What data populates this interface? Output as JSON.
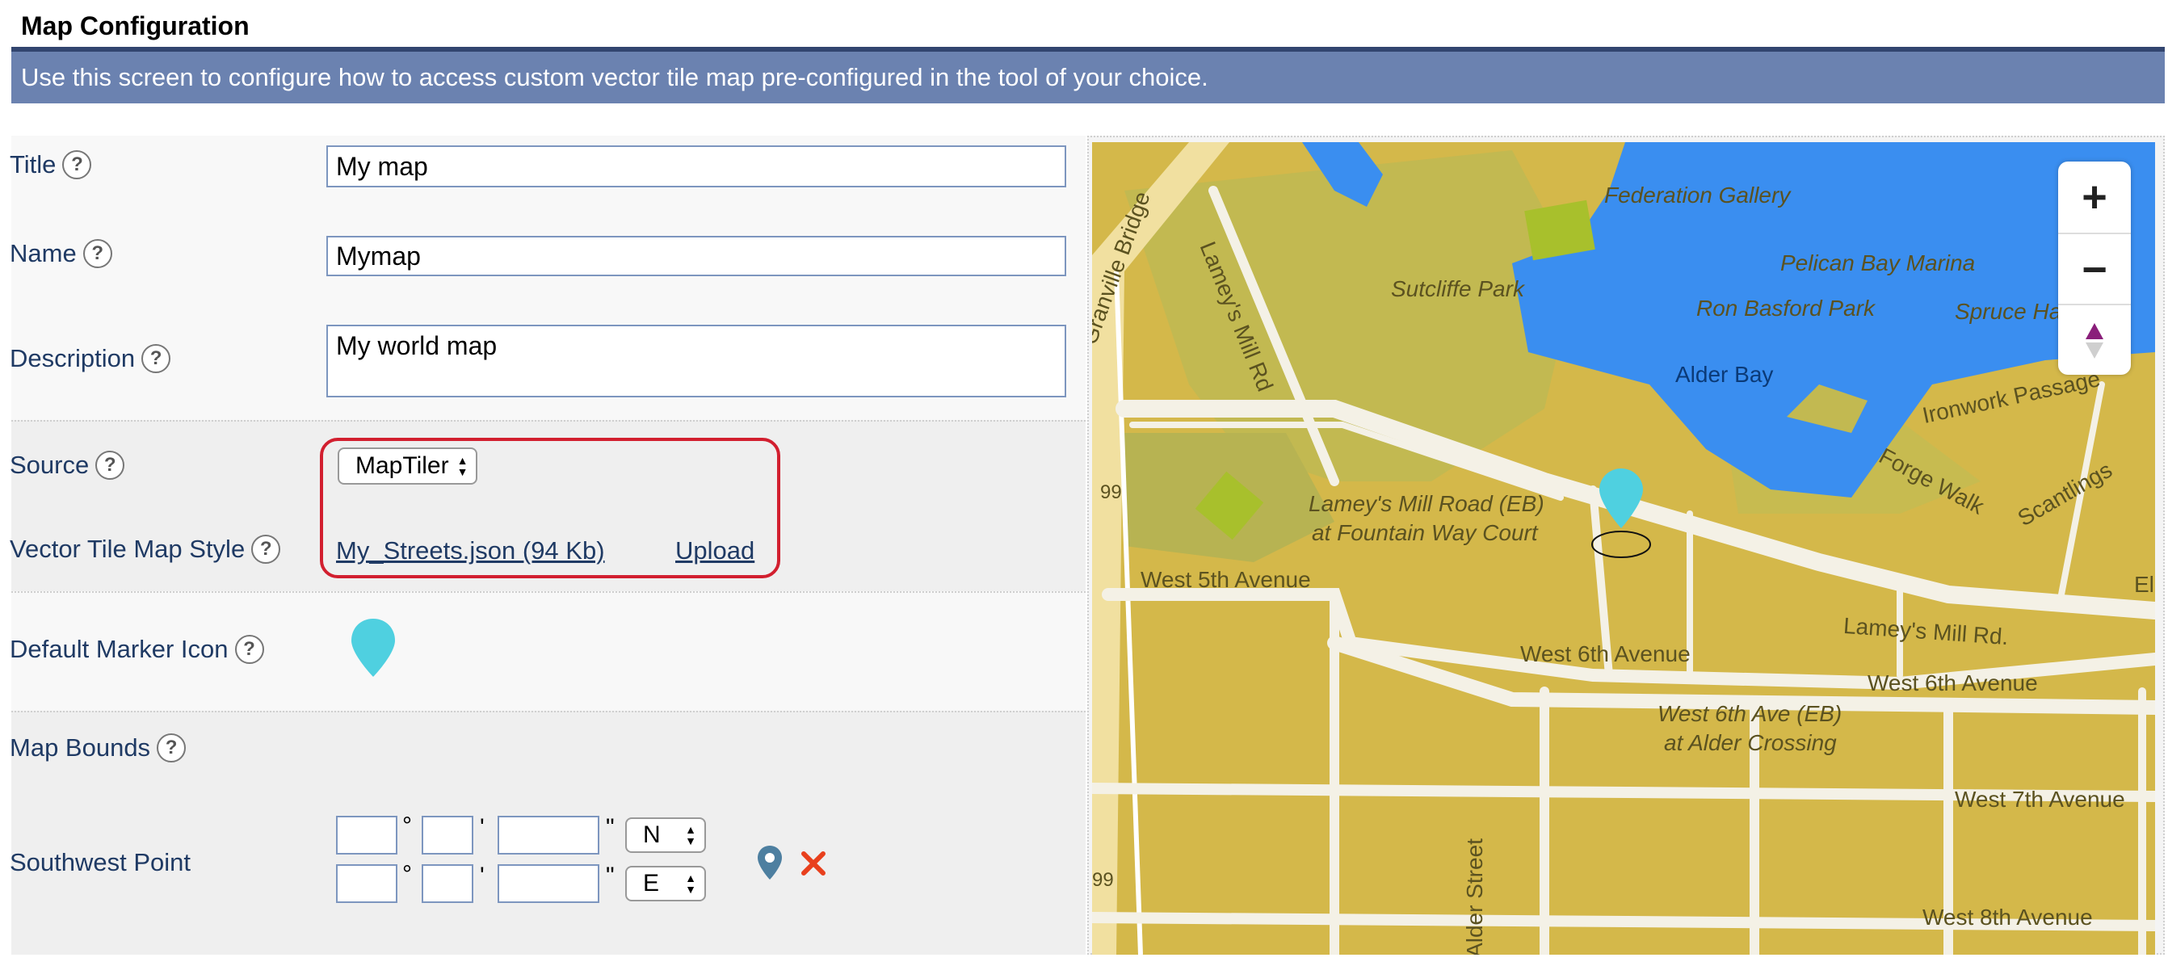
{
  "page_title": "Map Configuration",
  "info_text": "Use this screen to configure how to access custom vector tile map pre-configured in the tool of your choice.",
  "help_glyph": "?",
  "fields": {
    "title": {
      "label": "Title",
      "value": "My map"
    },
    "name": {
      "label": "Name",
      "value": "Mymap"
    },
    "description": {
      "label": "Description",
      "value": "My world map"
    },
    "source": {
      "label": "Source",
      "value": "MapTiler"
    },
    "style": {
      "label": "Vector Tile Map Style",
      "file_link": "My_Streets.json (94 Kb)",
      "upload_label": "Upload"
    },
    "marker": {
      "label": "Default Marker Icon"
    },
    "bounds": {
      "label": "Map Bounds"
    },
    "southwest": {
      "label": "Southwest Point",
      "degree_symbol": "°",
      "minute_symbol": "'",
      "second_symbol": "\"",
      "lat_dir": "N",
      "lon_dir": "E"
    }
  },
  "map": {
    "zoom_in_label": "+",
    "zoom_out_label": "−",
    "labels": {
      "federation_gallery": "Federation Gallery",
      "pelican_bay_marina": "Pelican Bay Marina",
      "sutcliffe_park": "Sutcliffe Park",
      "ron_basford_park": "Ron Basford Park",
      "spruce_harbour": "Spruce Harbour",
      "alder_bay": "Alder Bay",
      "ironwork_passage": "Ironwork Passage",
      "forge_walk": "Forge Walk",
      "scantlings": "Scantlings",
      "granville_bridge": "Granville Bridge",
      "lameys_mill_rd_vertical": "Lamey's Mill Rd",
      "lameys_mill_road_eb_line1": "Lamey's Mill Road (EB)",
      "lameys_mill_road_eb_line2": "at Fountain Way Court",
      "lameys_mill_rd_east": "Lamey's Mill Rd.",
      "west_5th_avenue": "West 5th Avenue",
      "west_6th_avenue_center": "West 6th Avenue",
      "west_6th_avenue_east": "West 6th Avenue",
      "west_6th_ave_eb_line1": "West 6th Ave (EB)",
      "west_6th_ave_eb_line2": "at Alder Crossing",
      "west_7th_avenue": "West 7th Avenue",
      "west_8th_avenue": "West 8th Avenue",
      "alder_street": "Alder Street",
      "elm_cut": "El",
      "route_99_top": "99",
      "route_99_bottom": "99"
    }
  }
}
